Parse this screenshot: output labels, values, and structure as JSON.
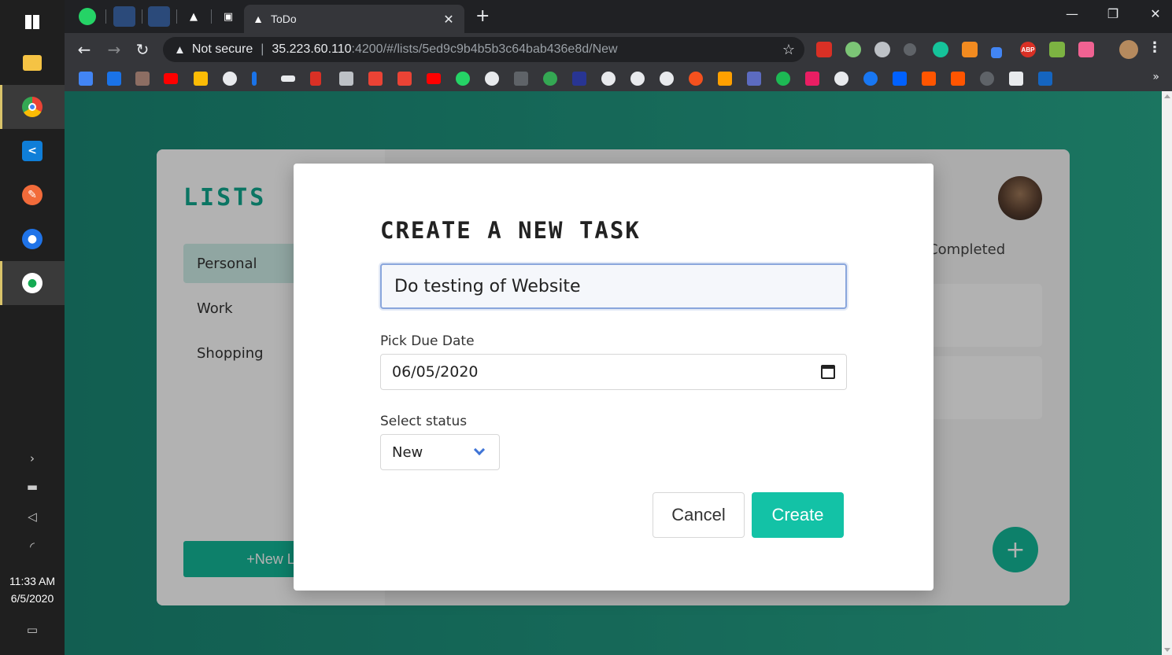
{
  "taskbar": {
    "time": "11:33 AM",
    "date": "6/5/2020"
  },
  "browser": {
    "tab_title": "ToDo",
    "url_warning": "Not secure",
    "url_host": "35.223.60.110",
    "url_rest": ":4200/#/lists/5ed9c9b4b5b3c64bab436e8d/New",
    "ext_abp": "ABP"
  },
  "app": {
    "lists_title": "LISTS",
    "lists": [
      {
        "label": "Personal"
      },
      {
        "label": "Work"
      },
      {
        "label": "Shopping"
      }
    ],
    "new_list_label": "+New List",
    "completed_label": "Completed",
    "fab_label": "+"
  },
  "modal": {
    "title": "CREATE A NEW TASK",
    "task_value": "Do testing of Website",
    "due_label": "Pick Due Date",
    "due_value": "06/05/2020",
    "status_label": "Select status",
    "status_value": "New",
    "cancel_label": "Cancel",
    "create_label": "Create"
  },
  "colors": {
    "accent": "#14b899",
    "background_gradient_start": "#1a8774",
    "background_gradient_end": "#27a88a"
  }
}
